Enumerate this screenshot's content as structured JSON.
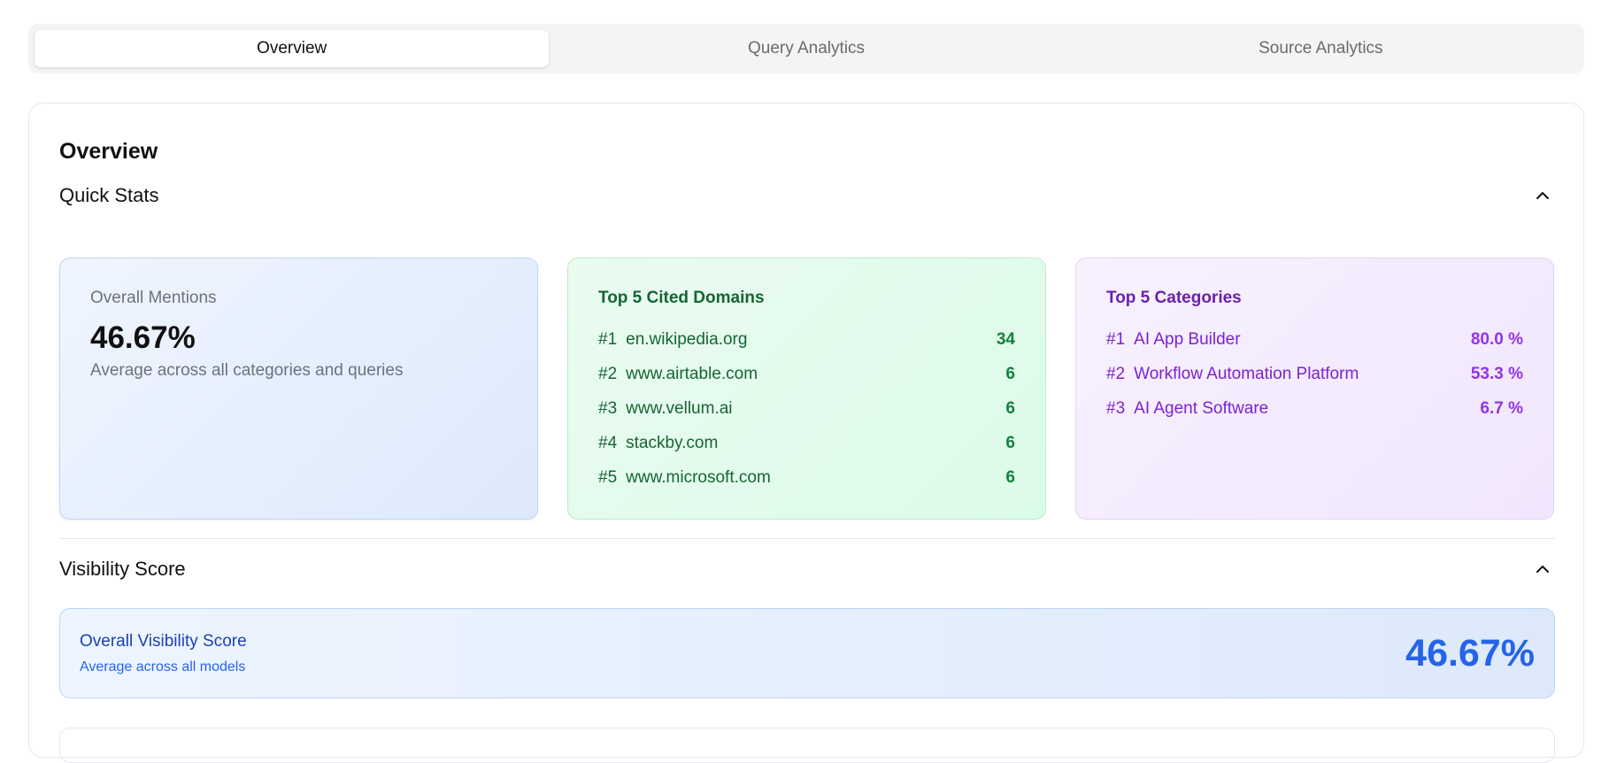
{
  "tabs": [
    {
      "label": "Overview",
      "active": true
    },
    {
      "label": "Query Analytics",
      "active": false
    },
    {
      "label": "Source Analytics",
      "active": false
    }
  ],
  "page_title": "Overview",
  "quick_stats": {
    "title": "Quick Stats",
    "mentions": {
      "label": "Overall Mentions",
      "value": "46.67%",
      "subtitle": "Average across all categories and queries"
    },
    "domains": {
      "title": "Top 5 Cited Domains",
      "items": [
        {
          "rank": "#1",
          "name": "en.wikipedia.org",
          "value": "34"
        },
        {
          "rank": "#2",
          "name": "www.airtable.com",
          "value": "6"
        },
        {
          "rank": "#3",
          "name": "www.vellum.ai",
          "value": "6"
        },
        {
          "rank": "#4",
          "name": "stackby.com",
          "value": "6"
        },
        {
          "rank": "#5",
          "name": "www.microsoft.com",
          "value": "6"
        }
      ]
    },
    "categories": {
      "title": "Top 5 Categories",
      "items": [
        {
          "rank": "#1",
          "name": "AI App Builder",
          "value": "80.0 %"
        },
        {
          "rank": "#2",
          "name": "Workflow Automation Platform",
          "value": "53.3 %"
        },
        {
          "rank": "#3",
          "name": "AI Agent Software",
          "value": "6.7 %"
        }
      ]
    }
  },
  "visibility": {
    "title": "Visibility Score",
    "card_title": "Overall Visibility Score",
    "card_subtitle": "Average across all models",
    "value": "46.67%"
  },
  "icons": {
    "collapse": "chevron-up-icon"
  },
  "colors": {
    "accent_blue": "#2563eb",
    "accent_green": "#15803d",
    "accent_purple": "#9333ea"
  }
}
